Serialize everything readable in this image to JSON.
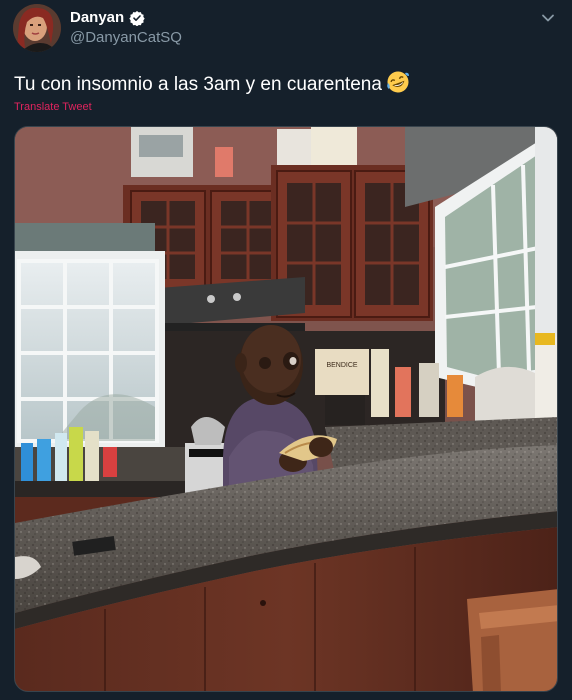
{
  "author": {
    "display_name": "Danyan",
    "handle": "@DanyanCatSQ",
    "verified": true,
    "avatar_icon": "profile-photo"
  },
  "tweet": {
    "text": "Tu con insomnio a las 3am y en cuarentena",
    "emoji": "rolling-on-floor-laughing-emoji",
    "translate_label": "Translate Tweet"
  },
  "media": {
    "type": "photo",
    "kitchen_sign_text": "BENDICE"
  },
  "colors": {
    "background": "#15202b",
    "secondary_text": "#8899a6",
    "translate_link": "#e0245e",
    "verified_badge": "#ffffff"
  }
}
